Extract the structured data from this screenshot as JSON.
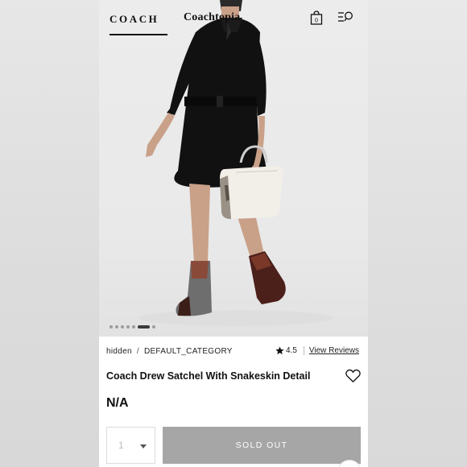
{
  "header": {
    "brand": "COACH",
    "tab_secondary": "Coachtopia",
    "bag_count": "0",
    "icons": [
      "shopping-bag-icon",
      "search-menu-icon"
    ]
  },
  "gallery": {
    "slide_count": 7,
    "active_slide": 6
  },
  "product": {
    "breadcrumb": [
      "hidden",
      "DEFAULT_CATEGORY"
    ],
    "breadcrumb_separator": "/",
    "rating": "4.5",
    "reviews_link": "View Reviews",
    "title": "Coach Drew Satchel With Snakeskin Detail",
    "price": "N/A"
  },
  "purchase": {
    "quantity": "1",
    "button_label": "SOLD OUT"
  },
  "colors": {
    "sold_out_bg": "#a6a6a6",
    "text": "#111111"
  }
}
